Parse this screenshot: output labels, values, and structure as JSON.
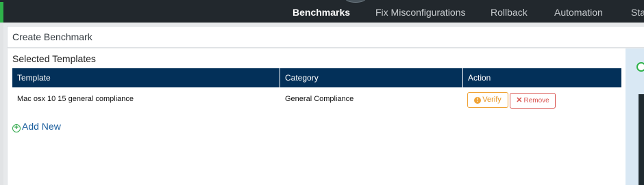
{
  "nav": {
    "items": [
      {
        "label": "Benchmarks",
        "active": true
      },
      {
        "label": "Fix Misconfigurations",
        "active": false
      },
      {
        "label": "Rollback",
        "active": false
      },
      {
        "label": "Automation",
        "active": false
      },
      {
        "label": "Sta",
        "active": false
      }
    ]
  },
  "page": {
    "title": "Create Benchmark",
    "section_title": "Selected Templates"
  },
  "table": {
    "columns": [
      "Template",
      "Category",
      "Action"
    ],
    "rows": [
      {
        "template": "Mac osx 10 15 general compliance",
        "category": "General Compliance",
        "verify_label": "Verify",
        "remove_label": "Remove"
      }
    ]
  },
  "add_new": {
    "label": "Add New"
  },
  "icons": {
    "verify": "warning-icon",
    "remove": "close-icon",
    "add": "plus-circle-icon"
  },
  "colors": {
    "nav_bg": "#22282d",
    "table_header": "#033059",
    "accent_green": "#2fb24a",
    "verify": "#f0a336",
    "remove": "#d9534f",
    "link": "#1c5f9e"
  }
}
